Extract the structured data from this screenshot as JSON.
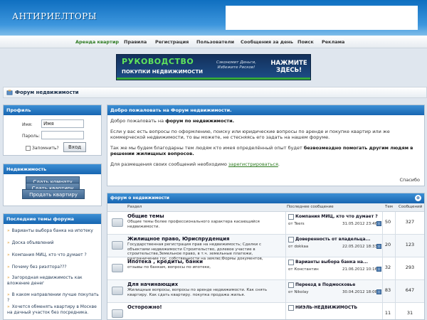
{
  "header": {
    "logo": "АНТИРИЕЛТОРЫ"
  },
  "nav": [
    {
      "label": "Аренда квартир",
      "active": true
    },
    {
      "label": "Правила"
    },
    {
      "label": "Регистрация"
    },
    {
      "label": "Пользователи"
    },
    {
      "label": "Сообщения за день"
    },
    {
      "label": "Поиск"
    },
    {
      "label": "Реклама"
    }
  ],
  "banner": {
    "title": "РУКОВОДСТВО",
    "subtitle": "ПОКУПКИ НЕДВИЖИМОСТИ",
    "middle": "Сэкономит Деньги, Избежите Рисков!",
    "cta_line1": "НАЖМИТЕ",
    "cta_line2": "ЗДЕСЬ!"
  },
  "forum_title": "Форум недвижимости",
  "profile": {
    "head": "Профиль",
    "name_label": "Имя:",
    "name_value": "Имя",
    "password_label": "Пароль:",
    "remember_label": "Запомнить?",
    "login_button": "Вход"
  },
  "realty": {
    "head": "Недвижимость",
    "buttons": [
      "Сдать комнату",
      "Сдать квартиру",
      "Продать квартиру"
    ]
  },
  "latest": {
    "head": "Последние темы форума",
    "items": [
      "Варианты выбора банка на ипотеку",
      "Доска объявлений",
      "Компания МИЦ, кто что думает ?",
      "Почему без риэлтора???",
      "Загородная недвижимость как вложение денег",
      "В каком направлении лучше покупать ?",
      "Хочется обменять квартиру в Москве на дачный участок без посредника."
    ]
  },
  "welcome": {
    "head": "Добро пожаловать на Форум недвижимости.",
    "p1_prefix": "Добро пожаловать на ",
    "p1_bold": "форум по недвижимости.",
    "p2": "Если у вас есть вопросы по оформлению, поиску или юридические вопросы по аренде и покупке квартир или же коммерческой недвижимости, то вы можете, не стесняясь его задать на нашем форуме.",
    "p3_prefix": "Так же мы будем благодарны тем людям кто имея определённый опыт будет ",
    "p3_bold": "безвозмездно помогать другим людям в решении жилищных вопросов.",
    "p4_prefix": "Для размещения своих сообщений необходимо ",
    "p4_link": "зарегистрироваться",
    "p4_suffix": ".",
    "close": "Спасибо"
  },
  "forum_table": {
    "category": "форум о недвижимости",
    "columns": {
      "section": "Раздел",
      "last_post": "Последнее сообщение",
      "topics": "Тем",
      "posts": "Сообщений"
    },
    "rows": [
      {
        "name": "Общие темы",
        "desc": "Общие темы более профессионального характера касающийся недвижимости.",
        "last_title": "Компания МИЦ, кто что думает ?",
        "last_by": "от Teers",
        "last_date": "31.05.2012 23:46",
        "topics": "50",
        "posts": "327"
      },
      {
        "name": "Жилищное право, Юриспруденция",
        "desc": "Государственная регистрация прав на недвижимость; Сделки с объектами недвижимости Строительство, долевое участие в строительстве,Земельное право, в т.ч. земельные платежи, разграничение гос. собственности на землю;Формы документов,",
        "last_title": "Доверенность от владельца...",
        "last_by": "от dokkaa",
        "last_date": "22.05.2012 18:33",
        "topics": "20",
        "posts": "123"
      },
      {
        "name": "Ипотека , кредиты, банки",
        "desc": "отзывы по банкам, вопросы по ипотеке,",
        "last_title": "Варианты выбора банка на...",
        "last_by": "от Константин",
        "last_date": "21.06.2012 10:16",
        "topics": "32",
        "posts": "293"
      },
      {
        "name": "Для начинающих",
        "desc": "Жилищные вопросы, вопросы по аренде недвижимости. Как снять квартиру. Как сдать квартиру. покупка продажа жилья.",
        "last_title": "Переезд в Подмосковье",
        "last_by": "от Nikolay",
        "last_date": "30.04.2012 18:08",
        "topics": "83",
        "posts": "647"
      },
      {
        "name": "Осторожно!",
        "desc": "",
        "last_title": "НИЭЛЬ-НЕДВИЖИМОСТЬ",
        "last_by": "",
        "last_date": "",
        "topics": "11",
        "posts": "31"
      }
    ]
  }
}
